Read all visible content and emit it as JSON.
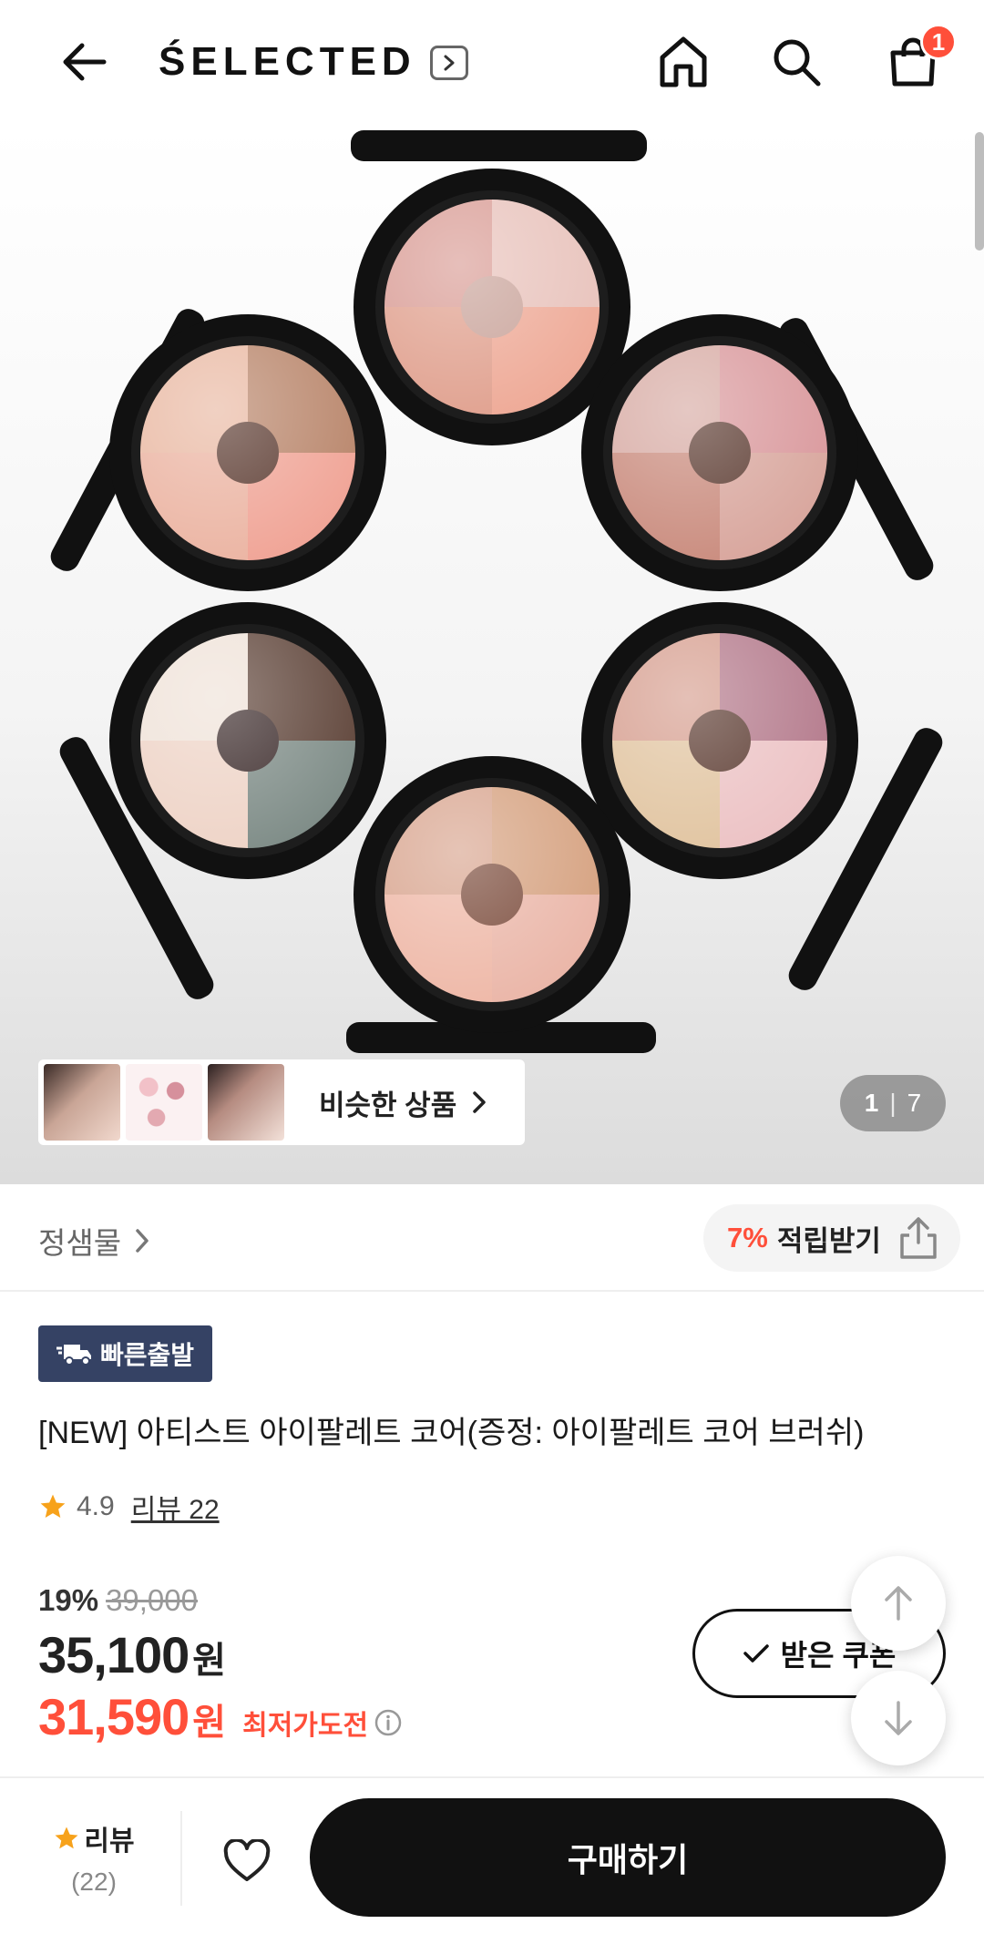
{
  "header": {
    "brand": "ŚELECTED",
    "cart_count": "1",
    "icons": [
      "back-arrow-icon",
      "chevron-right-icon",
      "home-icon",
      "search-icon",
      "shopping-bag-icon"
    ]
  },
  "hero": {
    "similar_label": "비슷한 상품",
    "page_current": "1",
    "page_separator": "|",
    "page_total": "7"
  },
  "seller": {
    "name": "정샘물",
    "points_percent": "7%",
    "points_label": "적립받기"
  },
  "product": {
    "badge": "빠른출발",
    "title": "[NEW] 아티스트 아이팔레트 코어(증정: 아이팔레트 코어 브러쉬)",
    "rating": "4.9",
    "review_link": "리뷰 22",
    "discount_percent": "19%",
    "original_price": "39,000",
    "price": "35,100",
    "price_unit": "원",
    "best_price": "31,590",
    "best_price_unit": "원",
    "best_price_label": "최저가도전"
  },
  "coupon": {
    "label": "받은 쿠폰"
  },
  "bottom_bar": {
    "review_label": "리뷰",
    "review_count": "(22)",
    "buy_label": "구매하기"
  },
  "colors": {
    "accent": "#ff4f3a",
    "badge_bg": "#354264",
    "star": "#f7a21b",
    "buy_button": "#111111"
  }
}
